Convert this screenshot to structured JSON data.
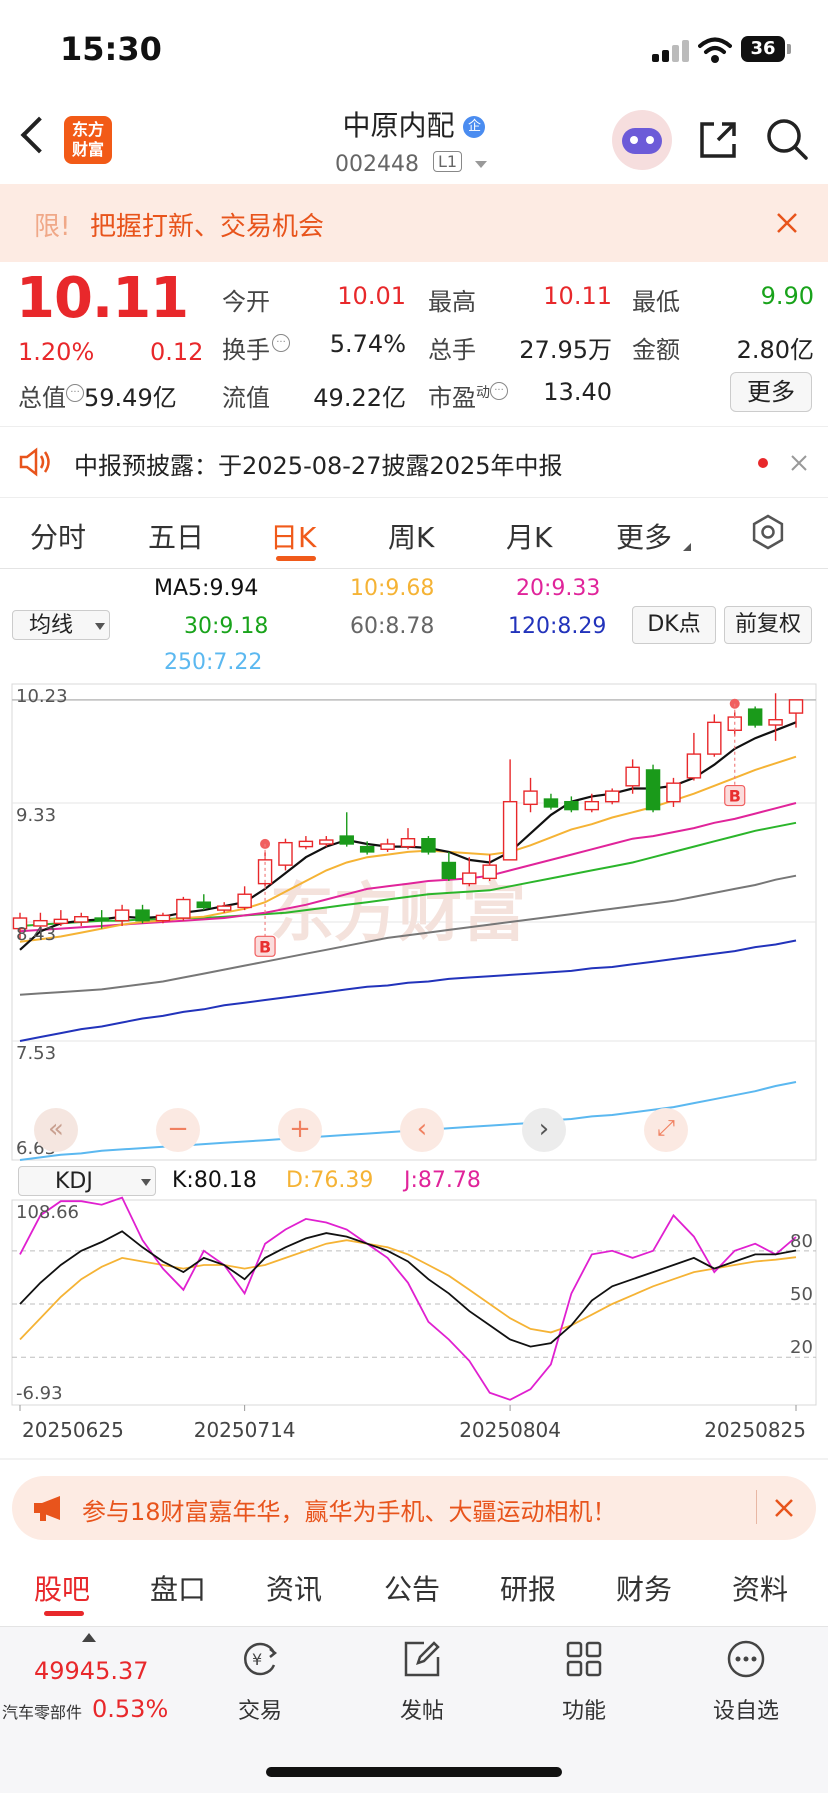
{
  "status": {
    "time": "15:30",
    "battery": "36"
  },
  "nav": {
    "logo_line1": "东方",
    "logo_line2": "财富",
    "name": "中原内配",
    "badge": "企",
    "code": "002448",
    "level": "L1"
  },
  "promo": {
    "prefix": "限!",
    "text": "把握打新、交易机会"
  },
  "quote": {
    "price": "10.11",
    "change_pct": "1.20%",
    "change": "0.12",
    "open_label": "今开",
    "open": "10.01",
    "high_label": "最高",
    "high": "10.11",
    "low_label": "最低",
    "low": "9.90",
    "turnover_label": "换手",
    "turnover": "5.74%",
    "volume_label": "总手",
    "volume": "27.95万",
    "amount_label": "金额",
    "amount": "2.80亿",
    "total_mv_label": "总值",
    "total_mv": "59.49亿",
    "float_mv_label": "流值",
    "float_mv": "49.22亿",
    "pe_label": "市盈",
    "pe_sup": "动",
    "pe": "13.40",
    "more": "更多"
  },
  "notice": {
    "text": "中报预披露：于2025-08-27披露2025年中报"
  },
  "ktabs": [
    "分时",
    "五日",
    "日K",
    "周K",
    "月K",
    "更多"
  ],
  "ma": {
    "selector": "均线",
    "ma5": "MA5:9.94",
    "ma10": "10:9.68",
    "ma20": "20:9.33",
    "ma30": "30:9.18",
    "ma60": "60:8.78",
    "ma120": "120:8.29",
    "ma250": "250:7.22",
    "dk": "DK点",
    "adjust": "前复权",
    "colors": {
      "ma5": "#111111",
      "ma10": "#f5b335",
      "ma20": "#e0249a",
      "ma30": "#2bb52b",
      "ma60": "#777777",
      "ma120": "#2233bb",
      "ma250": "#5bb8f0"
    }
  },
  "price_axis": [
    "10.23",
    "9.33",
    "8.43",
    "7.53",
    "6.63"
  ],
  "buy_mark": "B",
  "kdj": {
    "selector": "KDJ",
    "k": "K:80.18",
    "d": "D:76.39",
    "j": "J:87.78",
    "axis_top": "108.66",
    "axis_bottom": "-6.93",
    "level_80": "80",
    "level_50": "50",
    "level_20": "20"
  },
  "dates": [
    "20250625",
    "20250714",
    "20250804",
    "20250825"
  ],
  "chart_data": {
    "type": "candlestick",
    "price_range": [
      6.63,
      10.23
    ],
    "candles": [
      [
        8.38,
        8.46,
        8.5,
        8.3
      ],
      [
        8.4,
        8.44,
        8.5,
        8.38
      ],
      [
        8.42,
        8.45,
        8.52,
        8.4
      ],
      [
        8.43,
        8.47,
        8.5,
        8.4
      ],
      [
        8.46,
        8.44,
        8.52,
        8.38
      ],
      [
        8.44,
        8.52,
        8.56,
        8.4
      ],
      [
        8.52,
        8.44,
        8.56,
        8.42
      ],
      [
        8.44,
        8.48,
        8.5,
        8.42
      ],
      [
        8.46,
        8.6,
        8.62,
        8.44
      ],
      [
        8.58,
        8.54,
        8.64,
        8.52
      ],
      [
        8.52,
        8.55,
        8.58,
        8.5
      ],
      [
        8.54,
        8.64,
        8.7,
        8.52
      ],
      [
        8.72,
        8.9,
        8.96,
        8.7
      ],
      [
        8.86,
        9.03,
        9.06,
        8.82
      ],
      [
        9.0,
        9.04,
        9.08,
        8.98
      ],
      [
        9.02,
        9.05,
        9.08,
        9.0
      ],
      [
        9.08,
        9.02,
        9.26,
        9.0
      ],
      [
        9.0,
        8.96,
        9.04,
        8.94
      ],
      [
        8.98,
        9.02,
        9.06,
        8.96
      ],
      [
        9.0,
        9.06,
        9.14,
        8.98
      ],
      [
        9.06,
        8.96,
        9.08,
        8.94
      ],
      [
        8.88,
        8.76,
        8.96,
        8.74
      ],
      [
        8.72,
        8.8,
        8.92,
        8.7
      ],
      [
        8.76,
        8.86,
        8.94,
        8.74
      ],
      [
        8.9,
        9.34,
        9.66,
        8.9
      ],
      [
        9.32,
        9.42,
        9.52,
        9.26
      ],
      [
        9.36,
        9.3,
        9.4,
        9.28
      ],
      [
        9.34,
        9.28,
        9.38,
        9.26
      ],
      [
        9.28,
        9.34,
        9.4,
        9.26
      ],
      [
        9.34,
        9.42,
        9.44,
        9.32
      ],
      [
        9.46,
        9.6,
        9.66,
        9.4
      ],
      [
        9.58,
        9.28,
        9.62,
        9.26
      ],
      [
        9.34,
        9.48,
        9.52,
        9.3
      ],
      [
        9.52,
        9.7,
        9.86,
        9.5
      ],
      [
        9.7,
        9.94,
        10.0,
        9.68
      ],
      [
        9.88,
        9.98,
        10.02,
        9.84
      ],
      [
        10.04,
        9.92,
        10.06,
        9.9
      ],
      [
        9.92,
        9.96,
        10.16,
        9.8
      ],
      [
        10.01,
        10.11,
        10.11,
        9.9
      ]
    ],
    "ma5": [
      8.22,
      8.36,
      8.42,
      8.44,
      8.45,
      8.47,
      8.46,
      8.47,
      8.5,
      8.52,
      8.55,
      8.58,
      8.68,
      8.8,
      8.92,
      9.0,
      9.05,
      9.02,
      9.0,
      9.0,
      8.99,
      8.96,
      8.9,
      8.88,
      8.96,
      9.1,
      9.24,
      9.34,
      9.38,
      9.4,
      9.44,
      9.44,
      9.46,
      9.52,
      9.62,
      9.74,
      9.82,
      9.88,
      9.94
    ],
    "ma10": [
      8.28,
      8.3,
      8.32,
      8.35,
      8.38,
      8.41,
      8.43,
      8.44,
      8.46,
      8.47,
      8.5,
      8.53,
      8.58,
      8.66,
      8.74,
      8.82,
      8.88,
      8.92,
      8.94,
      8.96,
      8.97,
      8.96,
      8.95,
      8.94,
      8.96,
      9.01,
      9.07,
      9.13,
      9.17,
      9.22,
      9.26,
      9.3,
      9.35,
      9.4,
      9.46,
      9.52,
      9.58,
      9.63,
      9.68
    ],
    "ma20": [
      8.36,
      8.37,
      8.38,
      8.39,
      8.4,
      8.41,
      8.42,
      8.43,
      8.44,
      8.45,
      8.46,
      8.48,
      8.5,
      8.53,
      8.56,
      8.6,
      8.64,
      8.68,
      8.7,
      8.72,
      8.74,
      8.75,
      8.76,
      8.78,
      8.82,
      8.86,
      8.9,
      8.94,
      8.98,
      9.02,
      9.06,
      9.08,
      9.11,
      9.14,
      9.18,
      9.21,
      9.25,
      9.29,
      9.33
    ],
    "ma30": [
      8.4,
      8.41,
      8.42,
      8.43,
      8.44,
      8.44,
      8.45,
      8.45,
      8.46,
      8.46,
      8.47,
      8.48,
      8.49,
      8.5,
      8.52,
      8.54,
      8.56,
      8.58,
      8.6,
      8.62,
      8.64,
      8.65,
      8.66,
      8.67,
      8.7,
      8.73,
      8.76,
      8.79,
      8.82,
      8.85,
      8.88,
      8.92,
      8.96,
      9.0,
      9.04,
      9.08,
      9.12,
      9.15,
      9.18
    ],
    "ma60": [
      7.88,
      7.89,
      7.9,
      7.91,
      7.92,
      7.94,
      7.96,
      7.98,
      8.01,
      8.04,
      8.07,
      8.1,
      8.13,
      8.16,
      8.19,
      8.22,
      8.25,
      8.28,
      8.31,
      8.33,
      8.35,
      8.37,
      8.39,
      8.41,
      8.43,
      8.45,
      8.47,
      8.49,
      8.51,
      8.53,
      8.55,
      8.57,
      8.59,
      8.62,
      8.65,
      8.68,
      8.71,
      8.75,
      8.78
    ],
    "ma120": [
      7.53,
      7.56,
      7.59,
      7.62,
      7.64,
      7.67,
      7.7,
      7.72,
      7.75,
      7.77,
      7.8,
      7.82,
      7.84,
      7.86,
      7.88,
      7.9,
      7.92,
      7.94,
      7.95,
      7.97,
      7.98,
      8.0,
      8.01,
      8.02,
      8.03,
      8.04,
      8.05,
      8.06,
      8.08,
      8.09,
      8.11,
      8.13,
      8.15,
      8.17,
      8.19,
      8.21,
      8.24,
      8.26,
      8.29
    ],
    "ma250": [
      6.63,
      6.65,
      6.67,
      6.68,
      6.7,
      6.71,
      6.72,
      6.73,
      6.74,
      6.75,
      6.76,
      6.77,
      6.78,
      6.79,
      6.8,
      6.81,
      6.82,
      6.83,
      6.84,
      6.85,
      6.86,
      6.87,
      6.88,
      6.89,
      6.9,
      6.91,
      6.93,
      6.94,
      6.96,
      6.97,
      6.99,
      7.01,
      7.03,
      7.06,
      7.09,
      7.12,
      7.15,
      7.19,
      7.22
    ],
    "kdj_range": [
      -6.93,
      108.66
    ],
    "K": [
      50,
      62,
      72,
      80,
      85,
      91,
      82,
      74,
      68,
      76,
      72,
      64,
      76,
      82,
      87,
      90,
      88,
      84,
      80,
      74,
      64,
      56,
      46,
      38,
      30,
      26,
      28,
      38,
      52,
      60,
      64,
      68,
      72,
      76,
      70,
      74,
      78,
      78,
      80.18
    ],
    "D": [
      30,
      42,
      54,
      64,
      71,
      76,
      74,
      72,
      70,
      72,
      72,
      70,
      72,
      76,
      80,
      84,
      86,
      84,
      82,
      78,
      72,
      66,
      58,
      50,
      42,
      36,
      34,
      38,
      44,
      50,
      55,
      60,
      64,
      68,
      70,
      72,
      74,
      75,
      76.39
    ],
    "J": [
      78,
      100,
      108,
      108,
      106,
      110,
      86,
      70,
      58,
      80,
      72,
      56,
      84,
      92,
      98,
      96,
      92,
      84,
      76,
      62,
      40,
      30,
      18,
      0,
      -4,
      2,
      16,
      56,
      78,
      80,
      76,
      80,
      100,
      88,
      68,
      80,
      84,
      78,
      87.78
    ],
    "buy_points": [
      12,
      35
    ]
  },
  "promo2": {
    "text": "参与18财富嘉年华，赢华为手机、大疆运动相机！"
  },
  "bottom_tabs": [
    "股吧",
    "盘口",
    "资讯",
    "公告",
    "研报",
    "财务",
    "资料"
  ],
  "toolbar": {
    "index_value": "49945.37",
    "index_name": "汽车零部件",
    "index_change": "0.53%",
    "trade": "交易",
    "post": "发帖",
    "function": "功能",
    "watch": "设自选"
  }
}
